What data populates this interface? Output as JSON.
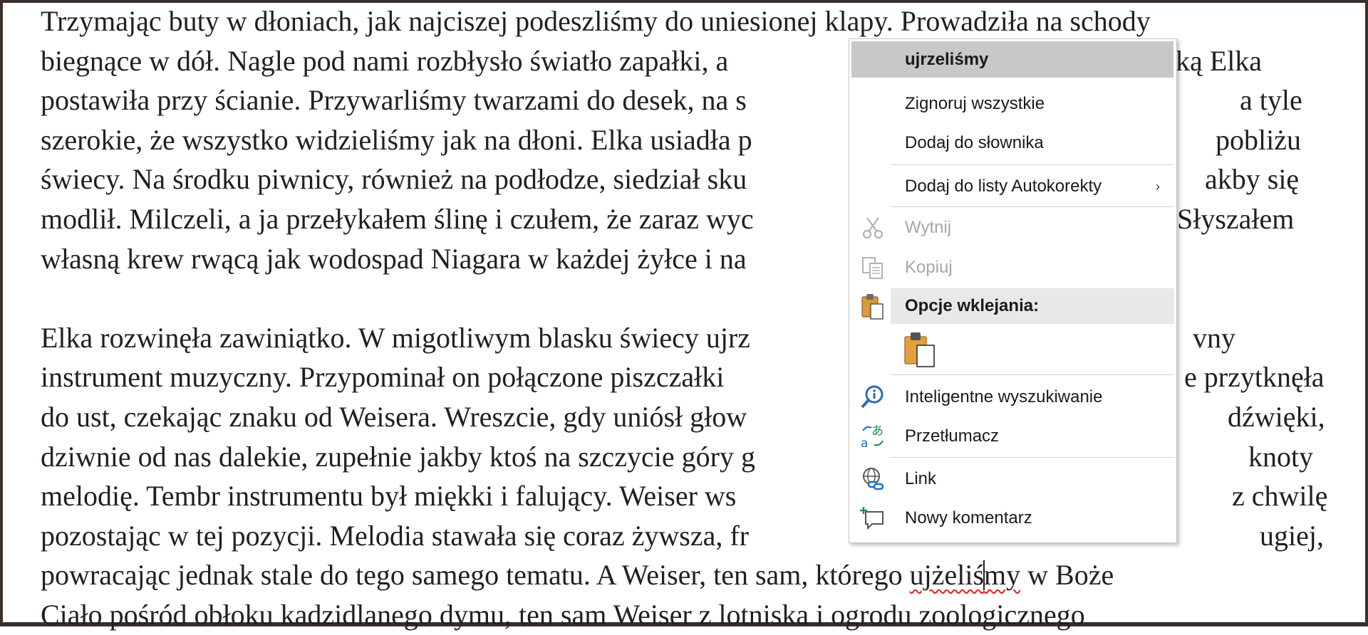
{
  "document": {
    "paragraph1": [
      "Trzymając buty w dłoniach, jak najciszej podeszliśmy do uniesionej klapy. Prowadziła na schody",
      "biegnące w dół. Nagle pod nami rozbłysło światło zapałki, a",
      "postawiła przy ścianie. Przywarliśmy twarzami do desek, na s",
      "szerokie, że wszystko widzieliśmy jak na dłoni. Elka usiadła p",
      "świecy. Na środku piwnicy, również na podłodze, siedział sku",
      "modlił. Milczeli, a ja przełykałem ślinę i czułem, że zaraz wyc",
      "własną krew rwącą jak wodospad Niagara w każdej żyłce i na"
    ],
    "paragraph1_right": [
      "",
      "ką Elka",
      "a tyle",
      "pobliżu",
      "akby się",
      "Słyszałem",
      ""
    ],
    "paragraph2": [
      "Elka rozwinęła zawiniątko. W migotliwym blasku świecy ujrz",
      "instrument muzyczny. Przypominał on połączone piszczałki",
      "do ust, czekając znaku od Weisera. Wreszcie, gdy uniósł głow",
      "dziwnie od nas dalekie, zupełnie jakby ktoś na szczycie góry g",
      "melodię. Tembr instrumentu był miękki i falujący. Weiser ws",
      "pozostając w tej pozycji. Melodia stawała się coraz żywsza, fr"
    ],
    "paragraph2_right": [
      "vny",
      "e przytknęła",
      "dźwięki,",
      "knoty",
      "z chwilę",
      "ugiej,"
    ],
    "line_13_before": "powracając jednak stale do tego samego tematu. A Weiser, ten sam, którego ",
    "line_13_misspelled_a": "ujżeliś",
    "line_13_misspelled_b": "my",
    "line_13_after": " w Boże",
    "line_14": "Ciało pośród obłoku kadzidlanego dymu, ten sam Weiser z lotniska i ogrodu zoologicznego"
  },
  "context_menu": {
    "suggestion": "ujrzeliśmy",
    "ignore_all": "Zignoruj wszystkie",
    "add_to_dictionary": "Dodaj do słownika",
    "add_to_autocorrect": "Dodaj do listy Autokorekty",
    "submenu_arrow": "›",
    "cut": "Wytnij",
    "copy": "Kopiuj",
    "paste_options_header": "Opcje wklejania:",
    "smart_lookup": "Inteligentne wyszukiwanie",
    "translate": "Przetłumacz",
    "link": "Link",
    "new_comment": "Nowy komentarz",
    "icons": {
      "cut": "scissors-icon",
      "copy": "copy-icon",
      "paste": "clipboard-icon",
      "paste_keep_text": "paste-keep-text-only-icon",
      "smart_lookup": "smart-lookup-icon",
      "translate": "translate-icon",
      "link": "link-icon",
      "new_comment": "new-comment-icon"
    },
    "colors": {
      "suggestion_bg": "#c8c8c8",
      "header_bg": "#e8e8e8",
      "disabled_text": "#a6a6a6",
      "spell_error": "#e0201c"
    }
  }
}
